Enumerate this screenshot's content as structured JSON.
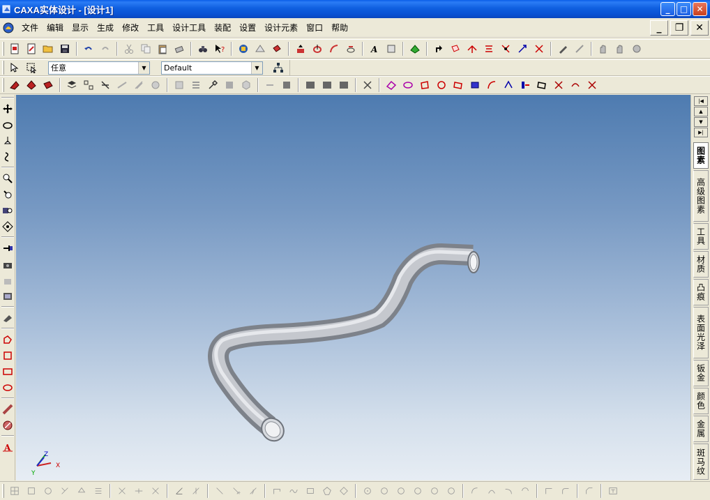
{
  "window": {
    "title": "CAXA实体设计 - [设计1]",
    "min_label": "_",
    "max_label": "□",
    "close_label": "✕"
  },
  "menu": {
    "items": [
      "文件",
      "编辑",
      "显示",
      "生成",
      "修改",
      "工具",
      "设计工具",
      "装配",
      "设置",
      "设计元素",
      "窗口",
      "帮助"
    ],
    "mdi_min": "_",
    "mdi_restore": "❐",
    "mdi_close": "✕"
  },
  "selection_bar": {
    "filter_value": "任意",
    "style_value": "Default"
  },
  "design_panel": {
    "tabs": [
      "图素",
      "高级图素",
      "工具",
      "材质",
      "凸痕",
      "表面光泽",
      "钣金",
      "颜色",
      "金属",
      "斑马纹"
    ],
    "active_tab": "图素"
  },
  "triad": {
    "x_label": "X",
    "y_label": "Y",
    "z_label": "Z"
  },
  "colors": {
    "titlebar": "#0a52d3",
    "viewport_top": "#4e7bb0",
    "viewport_bottom": "#e7edf4",
    "pipe": "#b4b8bf"
  }
}
